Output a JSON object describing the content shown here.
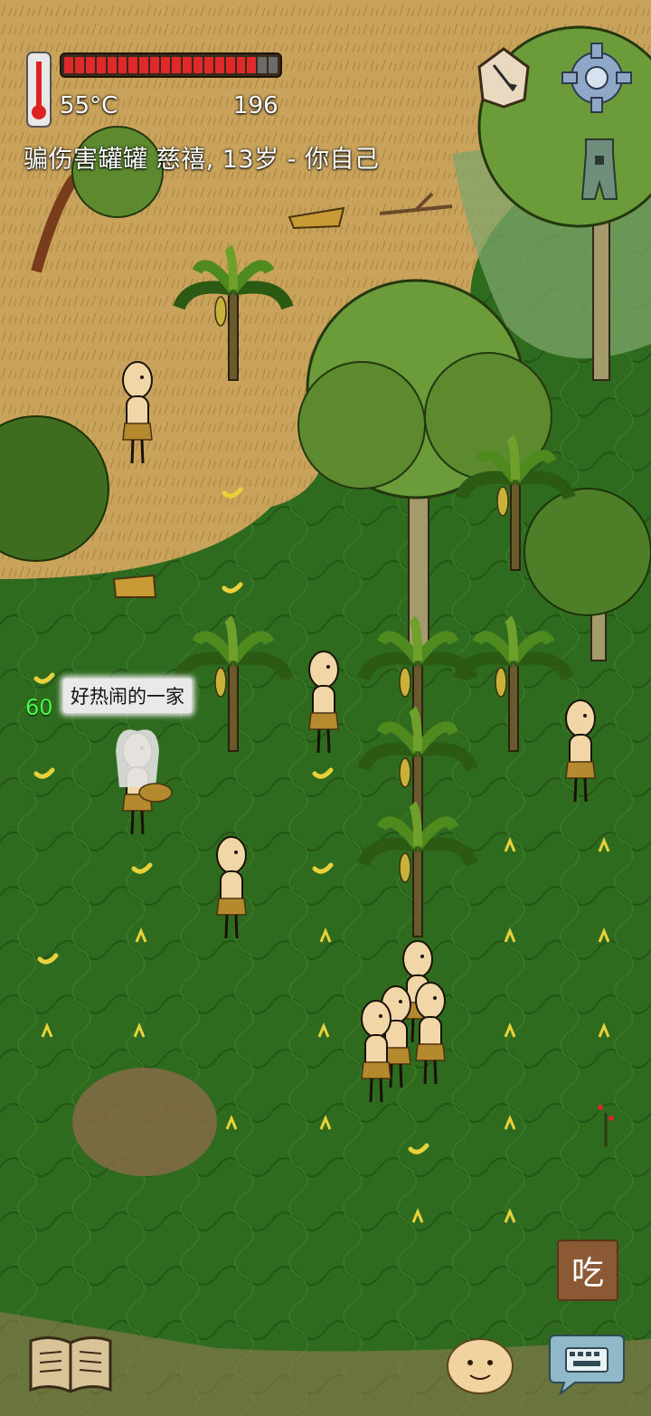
{
  "hud": {
    "temperature": "55°C",
    "food_count": "196",
    "food_fill": 0.9,
    "food_pips_total": 20,
    "player_label": "骗伤害罐罐 慈禧, 13岁 - 你自己"
  },
  "speech": {
    "age": "60",
    "text": "好热闹的一家"
  },
  "controls": {
    "eat_label": "吃"
  },
  "icons": {
    "thermometer": "thermometer-icon",
    "sundial": "sundial-icon",
    "settings": "gear-icon",
    "coin": "coin-icon",
    "book": "book-icon",
    "emote": "emote-face-icon",
    "keyboard": "keyboard-icon"
  },
  "colors": {
    "food_full": "#e0292b",
    "food_empty": "#6b6b6b",
    "age_text": "#46ff46",
    "grass": "#2f6b1f",
    "dry_ground": "#c9a35b"
  }
}
